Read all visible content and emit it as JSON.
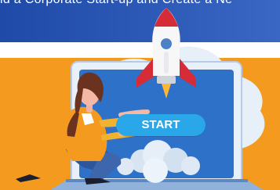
{
  "banner": {
    "text": "ld a Corporate Start-up and Create a Ne"
  },
  "main": {
    "start_button_label": "START"
  },
  "colors": {
    "orange_background": "#F49A1E",
    "banner_blue": "#2D59B7",
    "button_blue": "#2AA7E8",
    "laptop_frame": "#E8F0FA",
    "screen_background": "#2D72C8",
    "rocket_red": "#D62C38"
  }
}
